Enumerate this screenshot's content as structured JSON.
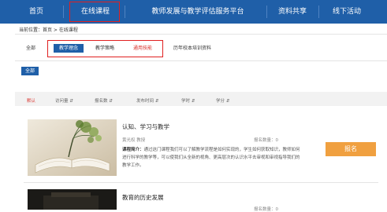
{
  "nav": {
    "items": [
      {
        "label": "首页"
      },
      {
        "label": "在线课程"
      },
      {
        "label": "教师发展与教学评估服务平台"
      },
      {
        "label": "资料共享"
      },
      {
        "label": "线下活动"
      }
    ]
  },
  "breadcrumb": "当前位置：首页 > 在线课程",
  "filters": {
    "all_label": "全部",
    "tags": [
      "教学理念",
      "教学策略",
      "通用技能",
      "历年校本培训资料"
    ]
  },
  "subfilter": {
    "all_label": "全部"
  },
  "sort": {
    "columns": [
      "默认",
      "访问量",
      "报名数",
      "发布时间",
      "学时",
      "学分"
    ]
  },
  "courses": [
    {
      "title": "认知、学习与教学",
      "teacher": "黄光权 教授",
      "count_label": "报名数量：0",
      "desc_label": "课程简介：",
      "desc": "通过这门课程我们可以了解教学流程是如何实现的，学生如何获取知识，教师如何进行科学的教学等，可以使我们从全新的视角、更高层次的认识水平去审视和审视指导我们的教学工作。",
      "button": "报名"
    },
    {
      "title": "教育的历史发展",
      "count_label": "报名数量：0"
    }
  ],
  "colors": {
    "brand": "#1f5fa8",
    "highlight": "#e02020",
    "action": "#f0a040",
    "skill_tag": "#d9302a"
  }
}
